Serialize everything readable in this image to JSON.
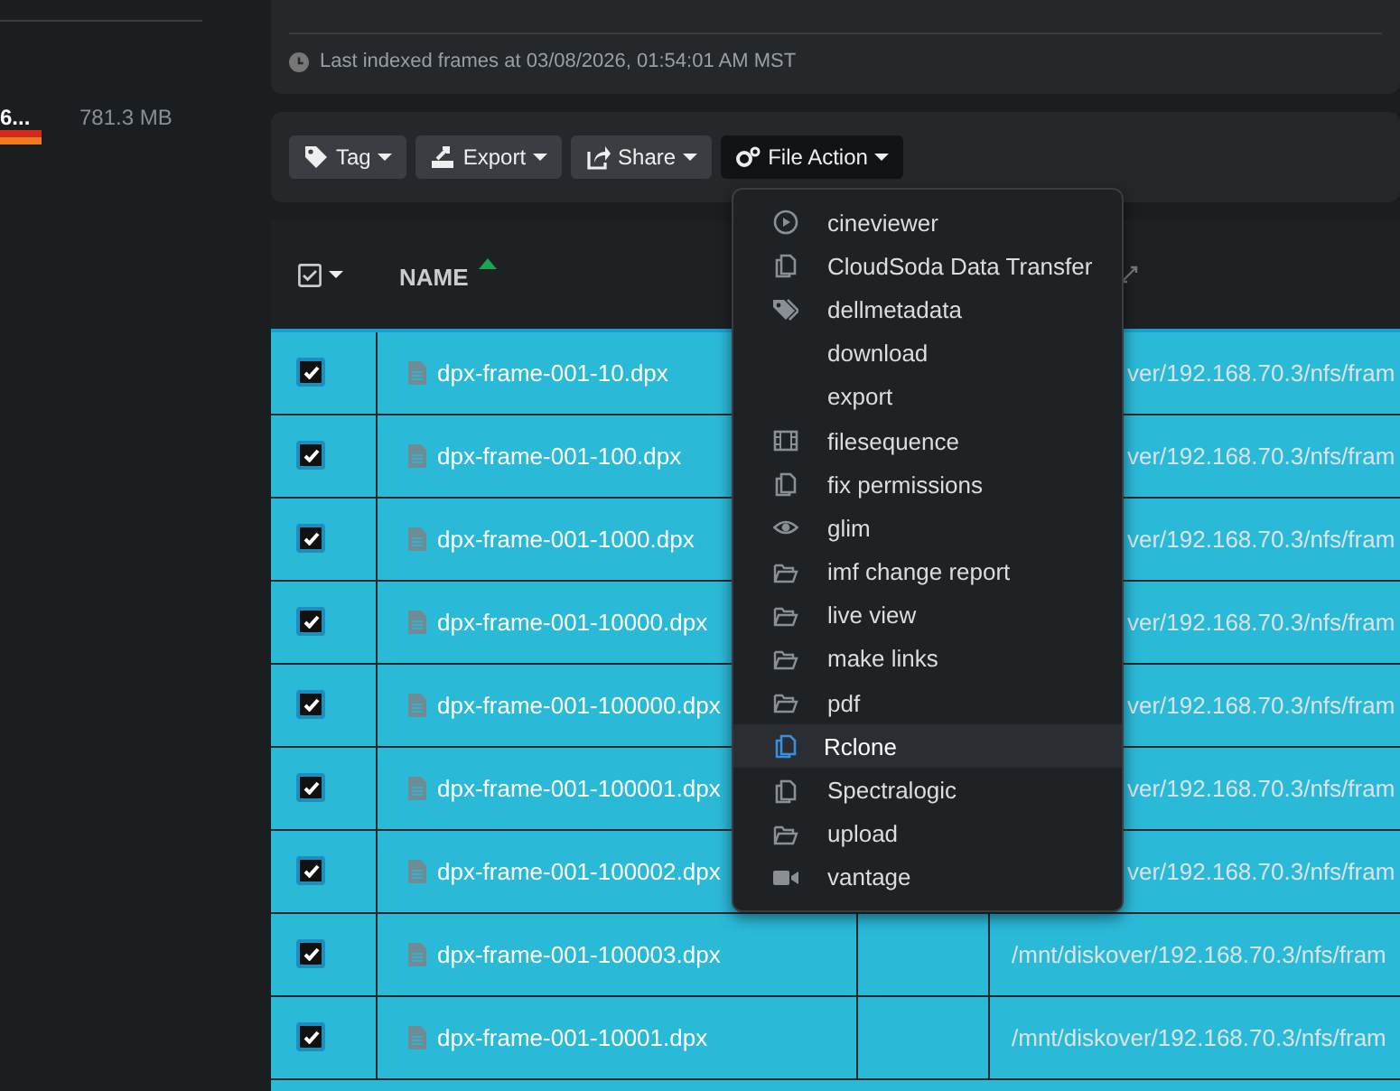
{
  "sidebar": {
    "item_label": "6...",
    "item_size": "781.3 MB"
  },
  "index_info": {
    "text": "Last indexed frames at 03/08/2026, 01:54:01 AM MST"
  },
  "toolbar": [
    {
      "label": "Tag",
      "kind": "tag",
      "active": false
    },
    {
      "label": "Export",
      "kind": "export",
      "active": false
    },
    {
      "label": "Share",
      "kind": "share",
      "active": false
    },
    {
      "label": "File Action",
      "kind": "gears",
      "active": true
    }
  ],
  "table": {
    "select_all_checked": true,
    "columns": [
      {
        "label": "NAME",
        "sorted": true
      }
    ],
    "rows": [
      {
        "checked": true,
        "name": "dpx-frame-001-10.dpx",
        "path": "ver/192.168.70.3/nfs/fram",
        "covered": true
      },
      {
        "checked": true,
        "name": "dpx-frame-001-100.dpx",
        "path": "ver/192.168.70.3/nfs/fram",
        "covered": true
      },
      {
        "checked": true,
        "name": "dpx-frame-001-1000.dpx",
        "path": "ver/192.168.70.3/nfs/fram",
        "covered": true
      },
      {
        "checked": true,
        "name": "dpx-frame-001-10000.dpx",
        "path": "ver/192.168.70.3/nfs/fram",
        "covered": true
      },
      {
        "checked": true,
        "name": "dpx-frame-001-100000.dpx",
        "path": "ver/192.168.70.3/nfs/fram",
        "covered": true
      },
      {
        "checked": true,
        "name": "dpx-frame-001-100001.dpx",
        "path": "ver/192.168.70.3/nfs/fram",
        "covered": true
      },
      {
        "checked": true,
        "name": "dpx-frame-001-100002.dpx",
        "path": "ver/192.168.70.3/nfs/fram",
        "covered": true
      },
      {
        "checked": true,
        "name": "dpx-frame-001-100003.dpx",
        "path": "/mnt/diskover/192.168.70.3/nfs/fram",
        "covered": false
      },
      {
        "checked": true,
        "name": "dpx-frame-001-10001.dpx",
        "path": "/mnt/diskover/192.168.70.3/nfs/fram",
        "covered": false
      }
    ]
  },
  "file_action_menu": [
    {
      "label": "cineviewer",
      "kind": "play",
      "selected": false
    },
    {
      "label": "CloudSoda Data Transfer",
      "kind": "copy",
      "selected": false
    },
    {
      "label": "dellmetadata",
      "kind": "tags",
      "selected": false
    },
    {
      "label": "download",
      "kind": "plain",
      "selected": false
    },
    {
      "label": "export",
      "kind": "plain",
      "selected": false
    },
    {
      "label": "filesequence",
      "kind": "film",
      "selected": false
    },
    {
      "label": "fix permissions",
      "kind": "copy",
      "selected": false
    },
    {
      "label": "glim",
      "kind": "eye",
      "selected": false
    },
    {
      "label": "imf change report",
      "kind": "folder",
      "selected": false
    },
    {
      "label": "live view",
      "kind": "folder",
      "selected": false
    },
    {
      "label": "make links",
      "kind": "folder",
      "selected": false
    },
    {
      "label": "pdf",
      "kind": "folder",
      "selected": false
    },
    {
      "label": "Rclone",
      "kind": "copy",
      "selected": true
    },
    {
      "label": "Spectralogic",
      "kind": "copy",
      "selected": false
    },
    {
      "label": "upload",
      "kind": "folder",
      "selected": false
    },
    {
      "label": "vantage",
      "kind": "video",
      "selected": false
    }
  ]
}
